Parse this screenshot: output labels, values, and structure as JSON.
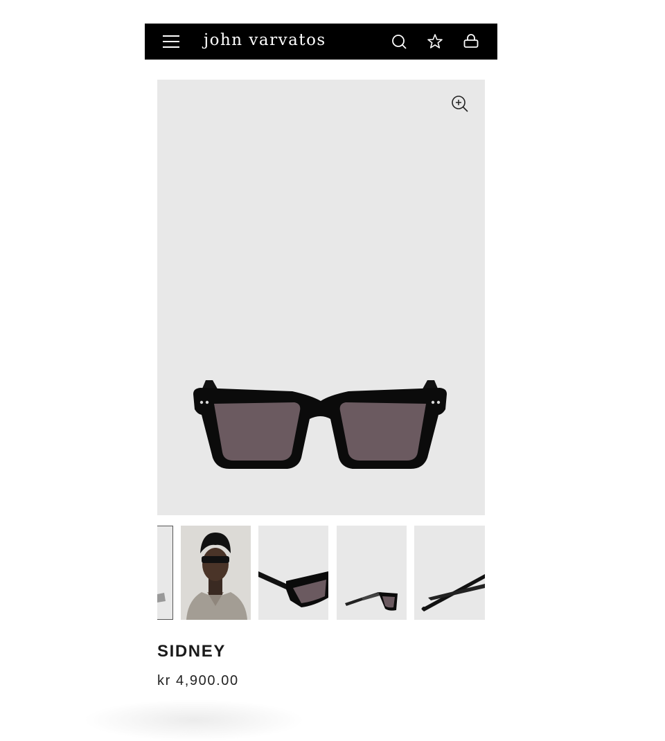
{
  "header": {
    "brand": "john varvatos",
    "icons": [
      "menu-icon",
      "search-icon",
      "star-icon",
      "bag-icon"
    ],
    "background": "#000000"
  },
  "gallery": {
    "zoom_icon": "zoom-in-icon",
    "main_background": "#e8e8e8",
    "thumbnails": [
      "partial-side-view",
      "model-wearing",
      "angled-view",
      "side-view",
      "temples-view"
    ]
  },
  "product": {
    "name": "SIDNEY",
    "price": "kr 4,900.00"
  },
  "colors": {
    "frame": "#0b0b0b",
    "lens": "#6b5a60"
  }
}
